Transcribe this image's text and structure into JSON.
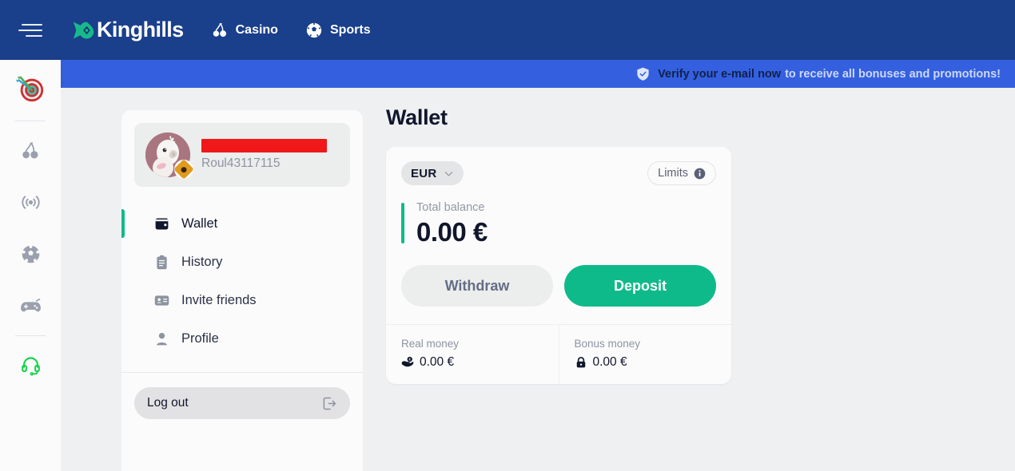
{
  "header": {
    "menu_icon": "hamburger-icon",
    "brand": "Kinghills",
    "brand_logo_icon": "kinghills-spade-logo",
    "nav": [
      {
        "label": "Casino",
        "icon": "cherries-icon"
      },
      {
        "label": "Sports",
        "icon": "soccer-ball-icon"
      }
    ]
  },
  "banner": {
    "icon": "shield-check-icon",
    "strong_text": "Verify your e-mail now",
    "rest_text": "to receive all bonuses and promotions!"
  },
  "rail": {
    "items": [
      {
        "name": "promotions",
        "icon": "dartboard-icon"
      },
      {
        "name": "casino",
        "icon": "cherries-icon"
      },
      {
        "name": "live-casino",
        "icon": "broadcast-icon"
      },
      {
        "name": "sports",
        "icon": "soccer-ball-icon"
      },
      {
        "name": "games",
        "icon": "gamepad-icon"
      },
      {
        "name": "support",
        "icon": "headset-icon"
      }
    ]
  },
  "panel": {
    "profile": {
      "avatar_icon": "cockatoo-avatar",
      "badge_icon": "rank-badge-icon",
      "display_name_redacted": true,
      "username": "Roul43117115"
    },
    "menu": [
      {
        "label": "Wallet",
        "icon": "wallet-icon",
        "active": true
      },
      {
        "label": "History",
        "icon": "clipboard-icon",
        "active": false
      },
      {
        "label": "Invite friends",
        "icon": "id-card-icon",
        "active": false
      },
      {
        "label": "Profile",
        "icon": "person-icon",
        "active": false
      }
    ],
    "logout": {
      "label": "Log out",
      "icon": "logout-icon"
    }
  },
  "wallet": {
    "title": "Wallet",
    "currency": {
      "label": "EUR",
      "chevron_icon": "chevron-down-icon"
    },
    "limits": {
      "label": "Limits",
      "icon": "info-icon"
    },
    "balance": {
      "label": "Total balance",
      "value": "0.00 €"
    },
    "actions": {
      "withdraw": "Withdraw",
      "deposit": "Deposit"
    },
    "breakdown": [
      {
        "label": "Real money",
        "value": "0.00 €",
        "icon": "money-hand-icon"
      },
      {
        "label": "Bonus money",
        "value": "0.00 €",
        "icon": "lock-icon"
      }
    ]
  },
  "colors": {
    "header_blue": "#1a3f8b",
    "banner_blue": "#3460e0",
    "accent_green": "#0fba8a",
    "page_bg": "#eff0f2",
    "redaction_red": "#f01818"
  }
}
